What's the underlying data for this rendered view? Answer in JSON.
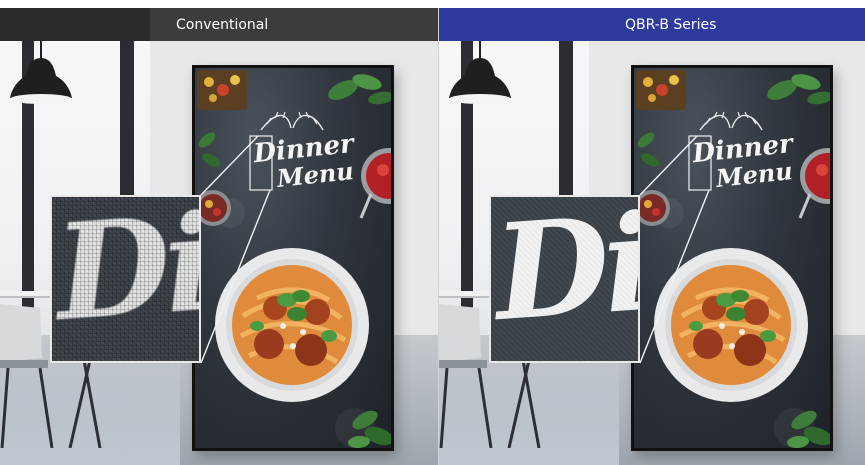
{
  "comparison": {
    "left_label": "Conventional",
    "right_label": "QBR-B Series",
    "colors": {
      "left_bar": "#3c3c3c",
      "right_bar": "#2e3b9c",
      "label_text": "#ffffff"
    }
  },
  "menu_board": {
    "title_line1": "Dinner",
    "title_line2": "Menu"
  },
  "zoom_inset": {
    "magnified_text": "Di"
  }
}
